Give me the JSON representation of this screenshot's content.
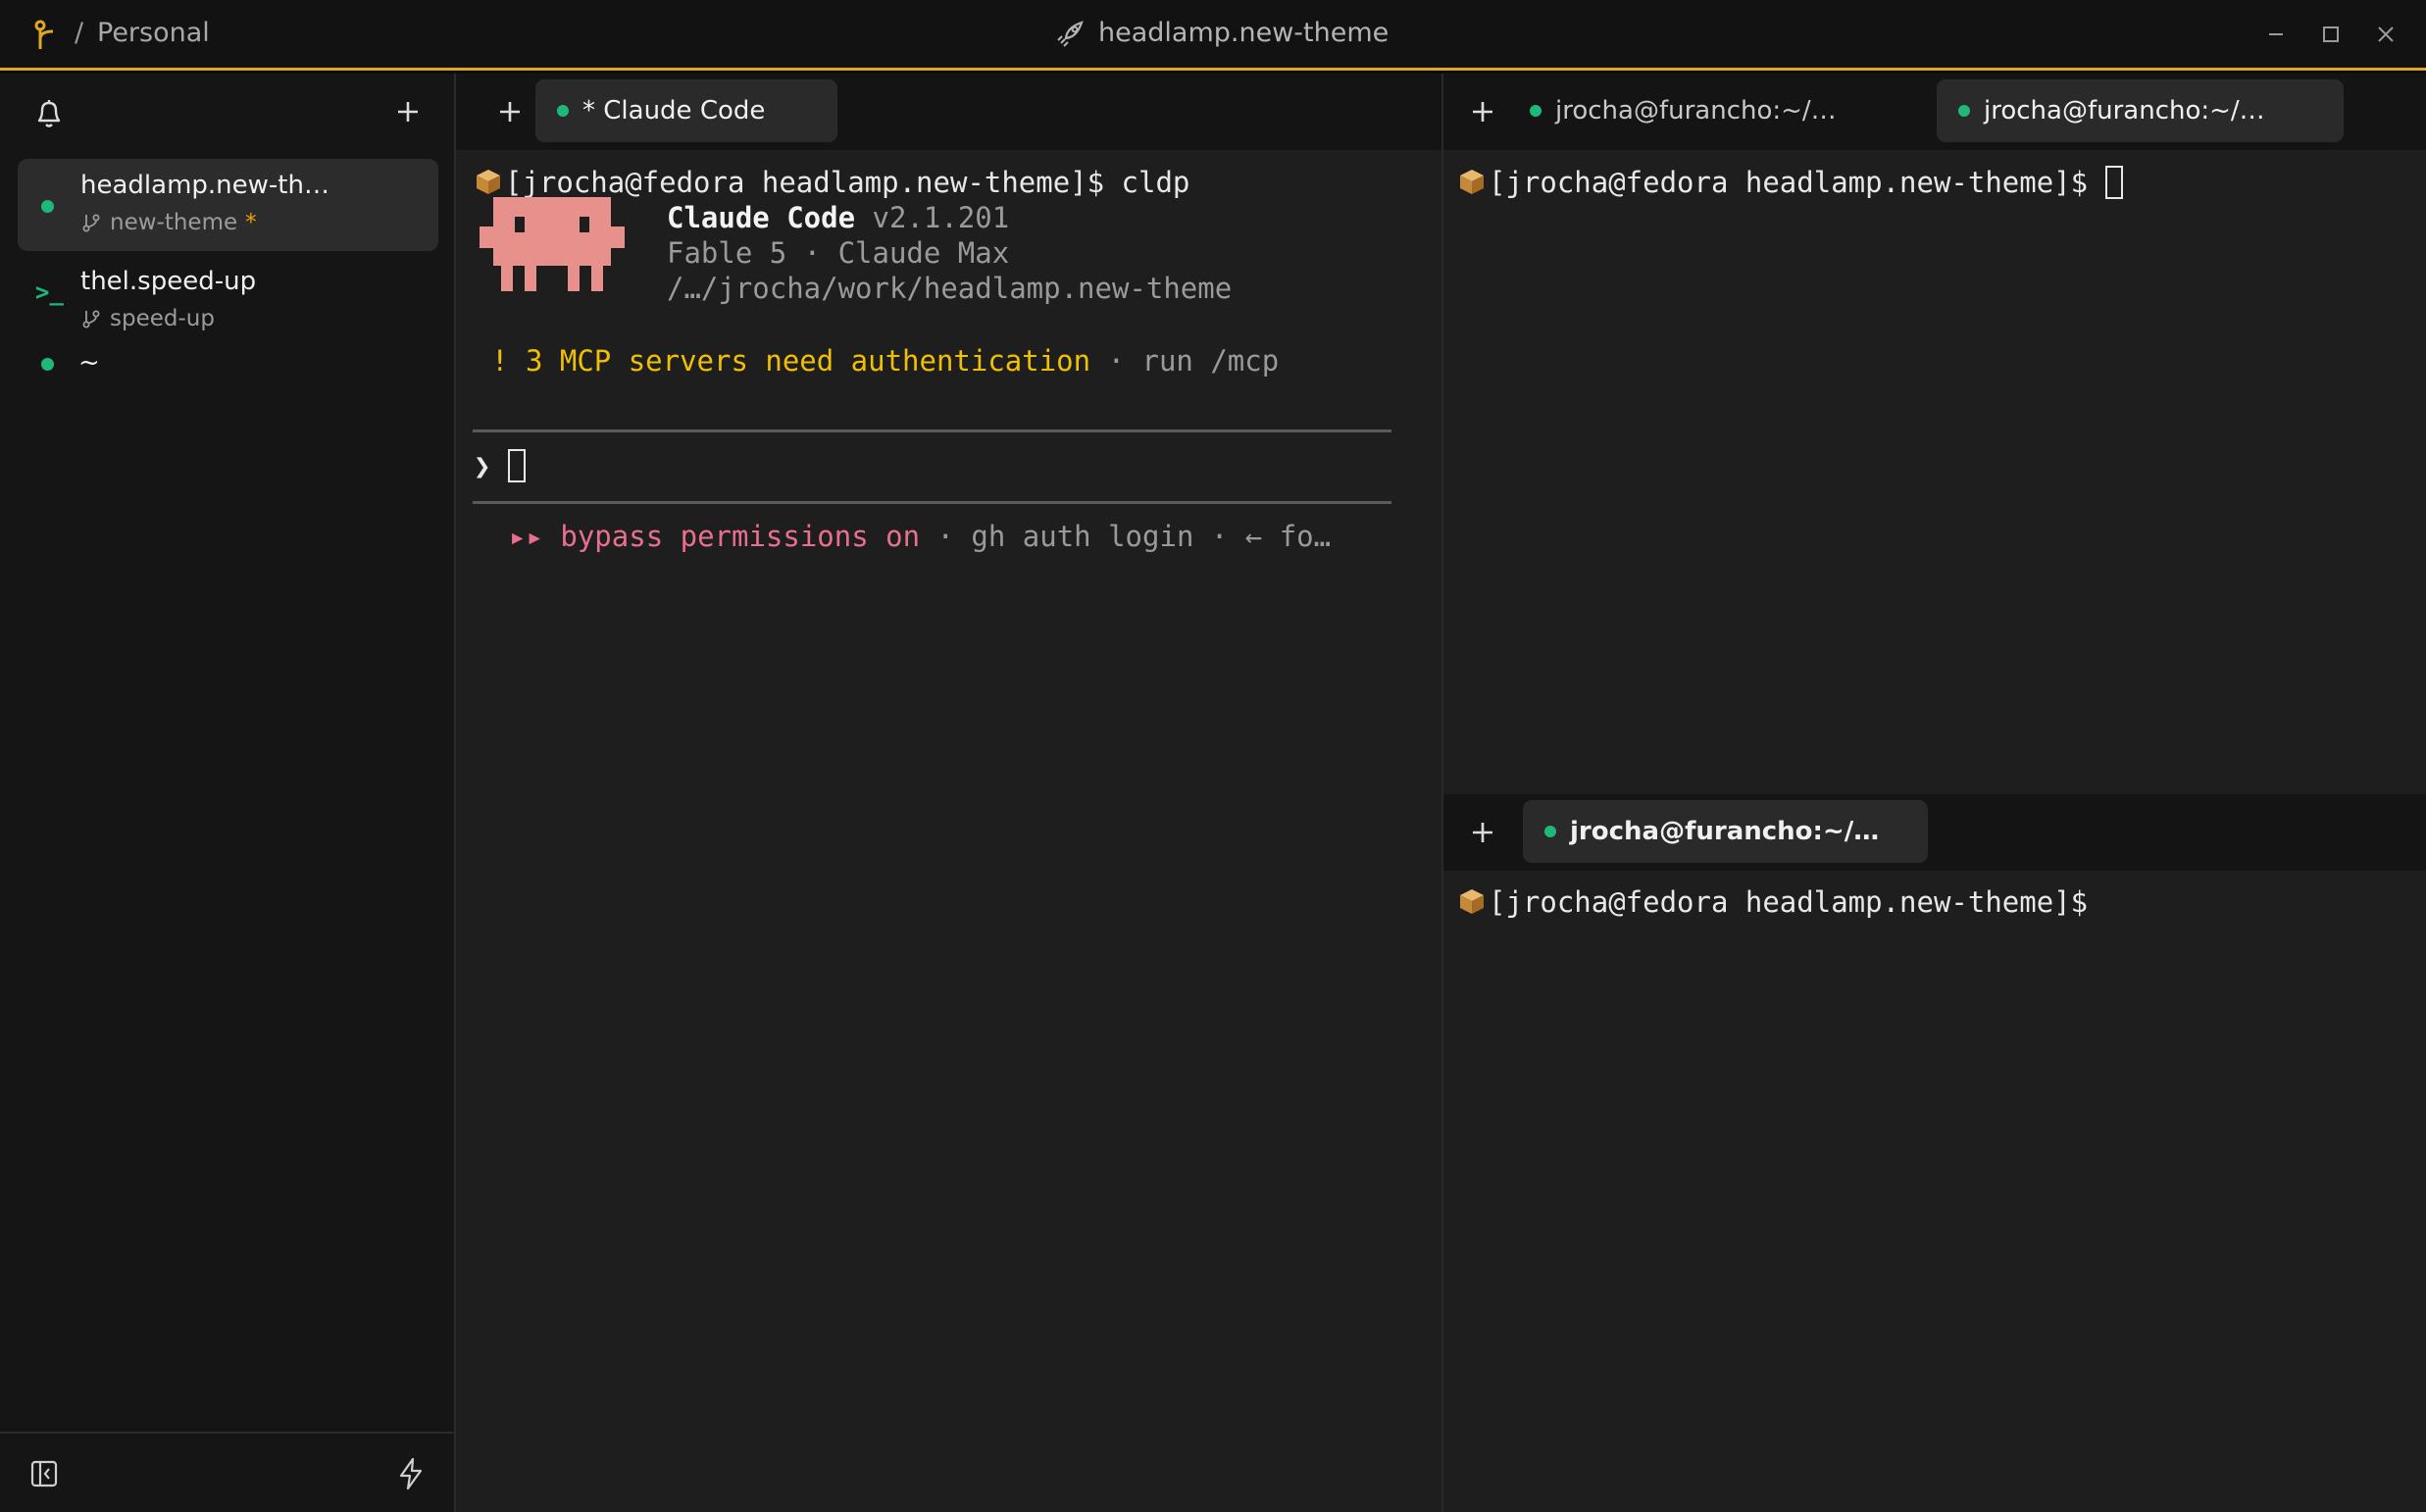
{
  "titlebar": {
    "separator": "/",
    "workspace": "Personal",
    "title": "headlamp.new-theme"
  },
  "sidebar": {
    "items": [
      {
        "title": "headlamp.new-th…",
        "branch": "new-theme",
        "modified": "*",
        "status": "running"
      },
      {
        "title": "thel.speed-up",
        "branch": "speed-up",
        "icon": ">_"
      },
      {
        "title": "~",
        "status": "running"
      }
    ]
  },
  "left_pane": {
    "tabs": [
      {
        "label": "* Claude Code",
        "active": true
      }
    ],
    "terminal": {
      "prompt": "[jrocha@fedora headlamp.new-theme]$ cldp",
      "app_name": "Claude Code",
      "app_version": "v2.1.201",
      "model_line": "Fable 5 · Claude Max",
      "path_line": "/…/jrocha/work/headlamp.new-theme",
      "warning_icon": "!",
      "warning_text": "3 MCP servers need authentication",
      "warning_hint": " · run /mcp",
      "input_caret": "❯",
      "mode_arrows": "▸▸",
      "mode_text": "bypass permissions on",
      "mode_hint": " · gh auth login · ← fo…"
    }
  },
  "right_top_pane": {
    "tabs": [
      {
        "label": "jrocha@furancho:~/…",
        "active": false
      },
      {
        "label": "jrocha@furancho:~/…",
        "active": true
      }
    ],
    "terminal": {
      "prompt": "[jrocha@fedora headlamp.new-theme]$ "
    }
  },
  "right_bottom_pane": {
    "tabs": [
      {
        "label": "jrocha@furancho:~/…",
        "active": true
      }
    ],
    "terminal": {
      "prompt": "[jrocha@fedora headlamp.new-theme]$"
    }
  },
  "colors": {
    "accent": "#e0a820",
    "running": "#1fb87a",
    "warning": "#f0c000",
    "mode": "#e8708e",
    "mascot": "#e8908c"
  }
}
